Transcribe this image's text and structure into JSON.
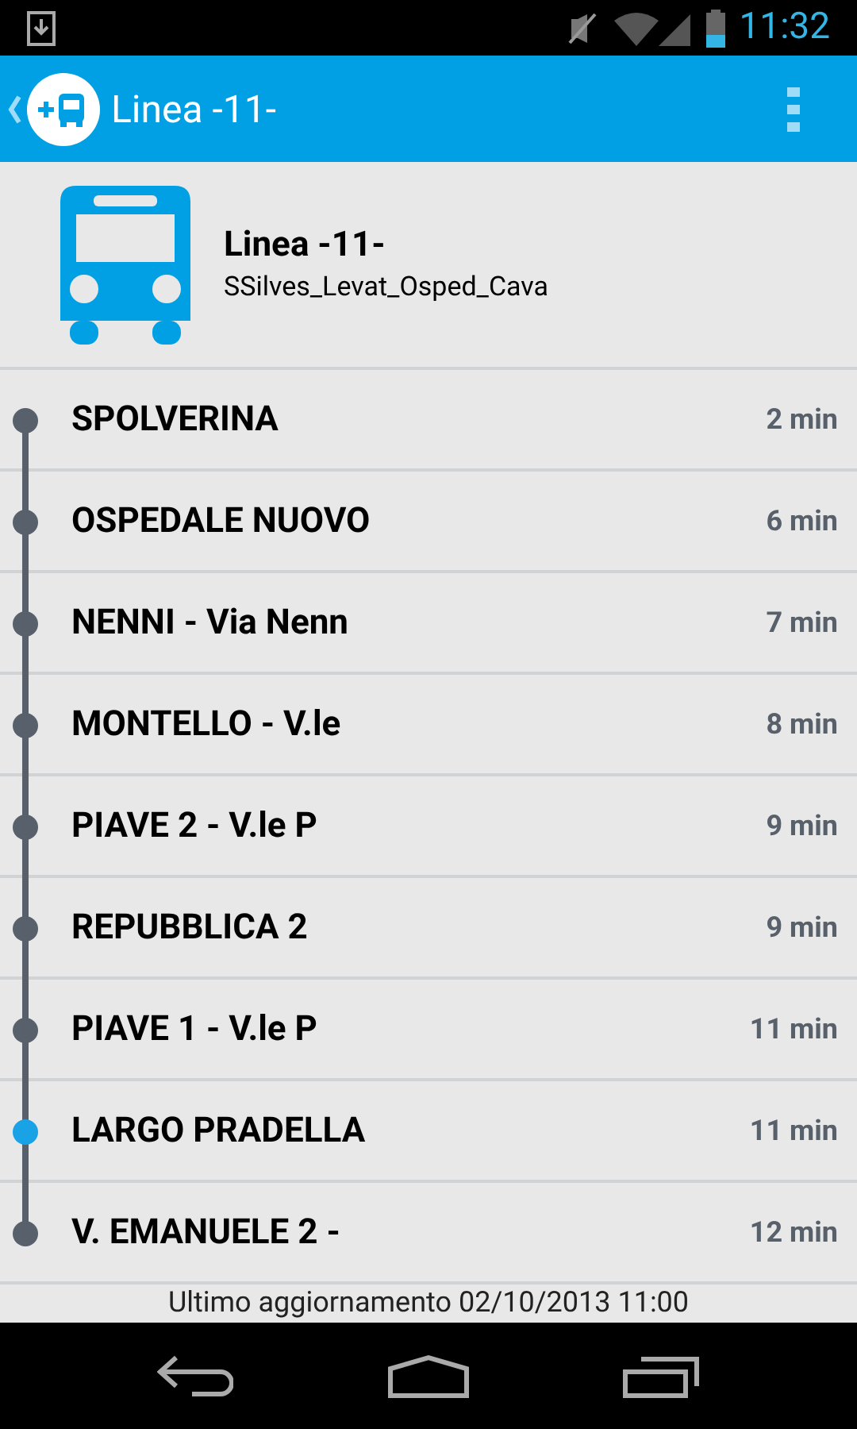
{
  "status_bar": {
    "time": "11:32"
  },
  "app_bar": {
    "title": "Linea -11-"
  },
  "line": {
    "name": "Linea -11-",
    "route": "SSilves_Levat_Osped_Cava"
  },
  "stops": [
    {
      "name": "SPOLVERINA",
      "time": "2 min",
      "current": false
    },
    {
      "name": "OSPEDALE NUOVO",
      "time": "6 min",
      "current": false
    },
    {
      "name": "NENNI - Via Nenn",
      "time": "7 min",
      "current": false
    },
    {
      "name": "MONTELLO - V.le",
      "time": "8 min",
      "current": false
    },
    {
      "name": "PIAVE 2 - V.le P",
      "time": "9 min",
      "current": false
    },
    {
      "name": "REPUBBLICA 2",
      "time": "9 min",
      "current": false
    },
    {
      "name": "PIAVE 1 - V.le P",
      "time": "11 min",
      "current": false
    },
    {
      "name": "LARGO PRADELLA",
      "time": "11 min",
      "current": true
    },
    {
      "name": "V. EMANUELE 2 -",
      "time": "12 min",
      "current": false
    }
  ],
  "footer": {
    "text": "Ultimo aggiornamento 02/10/2013 11:00"
  }
}
